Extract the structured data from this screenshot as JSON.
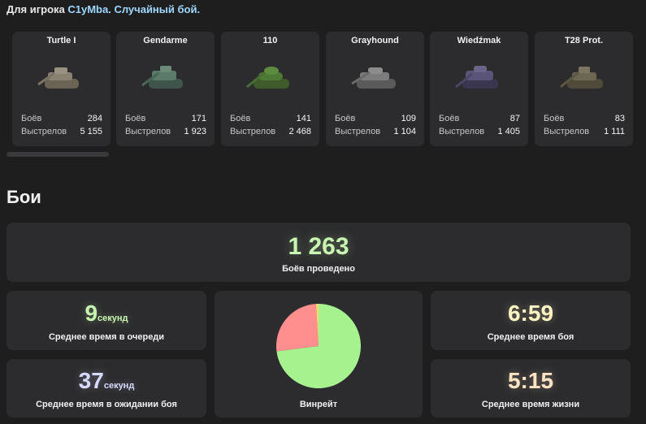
{
  "header": {
    "prefix": "Для игрока",
    "player": "C1yMba",
    "mode": "Случайный бой."
  },
  "tanks": [
    {
      "name": "Turtle I",
      "battles_label": "Боёв",
      "battles": "284",
      "shots_label": "Выстрелов",
      "shots": "5 155",
      "icon": "tank-icon"
    },
    {
      "name": "Gendarme",
      "battles_label": "Боёв",
      "battles": "171",
      "shots_label": "Выстрелов",
      "shots": "1 923",
      "icon": "tank-icon"
    },
    {
      "name": "110",
      "battles_label": "Боёв",
      "battles": "141",
      "shots_label": "Выстрелов",
      "shots": "2 468",
      "icon": "tank-icon"
    },
    {
      "name": "Grayhound",
      "battles_label": "Боёв",
      "battles": "109",
      "shots_label": "Выстрелов",
      "shots": "1 104",
      "icon": "tank-icon"
    },
    {
      "name": "Wiedźmak",
      "battles_label": "Боёв",
      "battles": "87",
      "shots_label": "Выстрелов",
      "shots": "1 405",
      "icon": "tank-icon"
    },
    {
      "name": "T28 Prot.",
      "battles_label": "Боёв",
      "battles": "83",
      "shots_label": "Выстрелов",
      "shots": "1 111",
      "icon": "tank-icon"
    }
  ],
  "battles_section": {
    "title": "Бои",
    "total": {
      "value": "1 263",
      "label": "Боёв проведено"
    },
    "queue_time": {
      "value": "9",
      "unit": "секунд",
      "label": "Среднее время в очереди"
    },
    "wait_time": {
      "value": "37",
      "unit": "секунд",
      "label": "Среднее время в ожидании боя"
    },
    "winrate": {
      "label": "Винрейт",
      "win_fraction": 0.73,
      "loss_fraction": 0.26,
      "draw_fraction": 0.01
    },
    "battle_time": {
      "value": "6:59",
      "label": "Среднее время боя"
    },
    "life_time": {
      "value": "5:15",
      "label": "Среднее время жизни"
    }
  },
  "colors": {
    "accent_green": "#c8f5b0",
    "win": "#a6f28f",
    "loss": "#ff8f8f",
    "draw": "#f7d774",
    "queue_value": "#c8f5b0",
    "wait_value": "#d7d9ff",
    "battle_time_value": "#fff3c4",
    "life_time_value": "#ffe3c2"
  }
}
